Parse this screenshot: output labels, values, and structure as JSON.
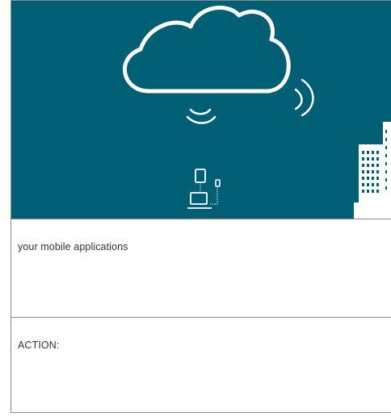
{
  "hero": {
    "background_color": "#005f74",
    "icons": [
      "cloud-icon",
      "wireless-signal-icon",
      "tablet-icon",
      "phone-icon",
      "laptop-icon",
      "building-icon"
    ]
  },
  "sections": [
    {
      "text": "your mobile applications"
    },
    {
      "text": "ACTION:"
    }
  ]
}
